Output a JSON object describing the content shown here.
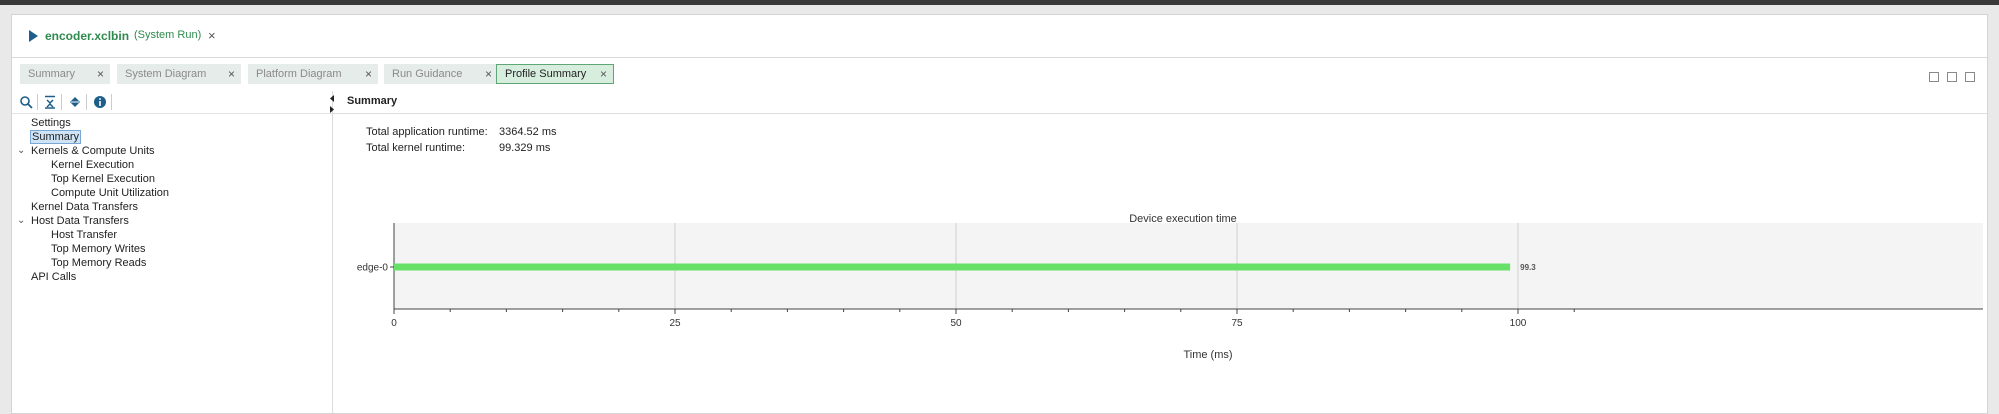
{
  "window": {
    "file_name": "encoder.xclbin",
    "run_label": "(System Run)",
    "close_glyph": "×"
  },
  "tabs": [
    {
      "label": "Summary",
      "close": "×",
      "active": false
    },
    {
      "label": "System Diagram",
      "close": "×",
      "active": false
    },
    {
      "label": "Platform Diagram",
      "close": "×",
      "active": false
    },
    {
      "label": "Run Guidance",
      "close": "×",
      "active": false
    },
    {
      "label": "Profile Summary",
      "close": "×",
      "active": true
    }
  ],
  "toolbar": {
    "icons": [
      "search-icon",
      "collapse-all-icon",
      "expand-all-icon",
      "info-icon"
    ]
  },
  "tree": [
    {
      "label": "Settings",
      "level": 0,
      "expandable": false
    },
    {
      "label": "Summary",
      "level": 0,
      "expandable": false,
      "selected": true
    },
    {
      "label": "Kernels & Compute Units",
      "level": 0,
      "expandable": true
    },
    {
      "label": "Kernel Execution",
      "level": 1,
      "expandable": false
    },
    {
      "label": "Top Kernel Execution",
      "level": 1,
      "expandable": false
    },
    {
      "label": "Compute Unit Utilization",
      "level": 1,
      "expandable": false
    },
    {
      "label": "Kernel Data Transfers",
      "level": 0,
      "expandable": false
    },
    {
      "label": "Host Data Transfers",
      "level": 0,
      "expandable": true
    },
    {
      "label": "Host Transfer",
      "level": 1,
      "expandable": false
    },
    {
      "label": "Top Memory Writes",
      "level": 1,
      "expandable": false
    },
    {
      "label": "Top Memory Reads",
      "level": 1,
      "expandable": false
    },
    {
      "label": "API Calls",
      "level": 0,
      "expandable": false
    }
  ],
  "main": {
    "section_title": "Summary",
    "stats": [
      {
        "label": "Total application runtime:",
        "value": "3364.52 ms"
      },
      {
        "label": "Total kernel runtime:",
        "value": "99.329 ms"
      }
    ]
  },
  "chart_data": {
    "type": "bar",
    "orientation": "horizontal",
    "title": "Device execution time",
    "xlabel": "Time (ms)",
    "ylabel": "",
    "categories": [
      "edge-0"
    ],
    "values": [
      99.3
    ],
    "value_labels": [
      "99.3"
    ],
    "xlim": [
      0,
      110
    ],
    "xticks": [
      "0",
      "25",
      "50",
      "75",
      "100"
    ],
    "grid": true,
    "bar_color": "#66e066"
  },
  "colors": {
    "accent_green": "#2f8a4e",
    "bar": "#66e066",
    "selection": "#cfe3f7"
  }
}
